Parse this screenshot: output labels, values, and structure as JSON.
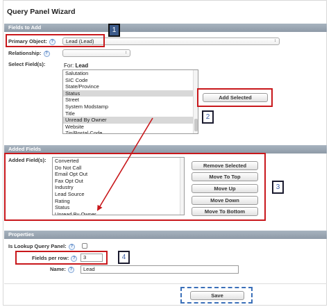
{
  "title": "Query Panel Wizard",
  "sections": {
    "fields_to_add": "Fields to Add",
    "added_fields": "Added Fields",
    "properties": "Properties"
  },
  "primary_object": {
    "label": "Primary Object:",
    "value": "Lead (Lead)"
  },
  "relationship": {
    "label": "Relationship:",
    "value": ""
  },
  "select_fields": {
    "label": "Select Field(s):",
    "for_prefix": "For:",
    "for_object": "Lead",
    "options": [
      "Salutation",
      "SIC Code",
      "State/Province",
      "Status",
      "Street",
      "System Modstamp",
      "Title",
      "Unread By Owner",
      "Website",
      "Zip/Postal Code"
    ],
    "selected": [
      "Status",
      "Unread By Owner"
    ]
  },
  "add_selected_label": "Add Selected",
  "added_fields": {
    "label": "Added Field(s):",
    "items": [
      "Converted",
      "Do Not Call",
      "Email Opt Out",
      "Fax Opt Out",
      "Industry",
      "Lead Source",
      "Rating",
      "Status",
      "Unread By Owner"
    ]
  },
  "move_buttons": {
    "remove_selected": "Remove Selected",
    "move_to_top": "Move To Top",
    "move_up": "Move Up",
    "move_down": "Move Down",
    "move_to_bottom": "Move To Bottom"
  },
  "properties": {
    "is_lookup_label": "Is Lookup Query Panel:",
    "is_lookup_checked": false,
    "fields_per_row_label": "Fields per row:",
    "fields_per_row_value": "3",
    "name_label": "Name:",
    "name_value": "Lead"
  },
  "help_glyph": "?",
  "save_label": "Save",
  "annotations": [
    "1",
    "2",
    "3",
    "4"
  ],
  "colors": {
    "annotation_red": "#c8171b",
    "section_bar": "#8e9aa7",
    "badge_text": "#3d5fa8",
    "save_dashed": "#3a6fb8"
  }
}
